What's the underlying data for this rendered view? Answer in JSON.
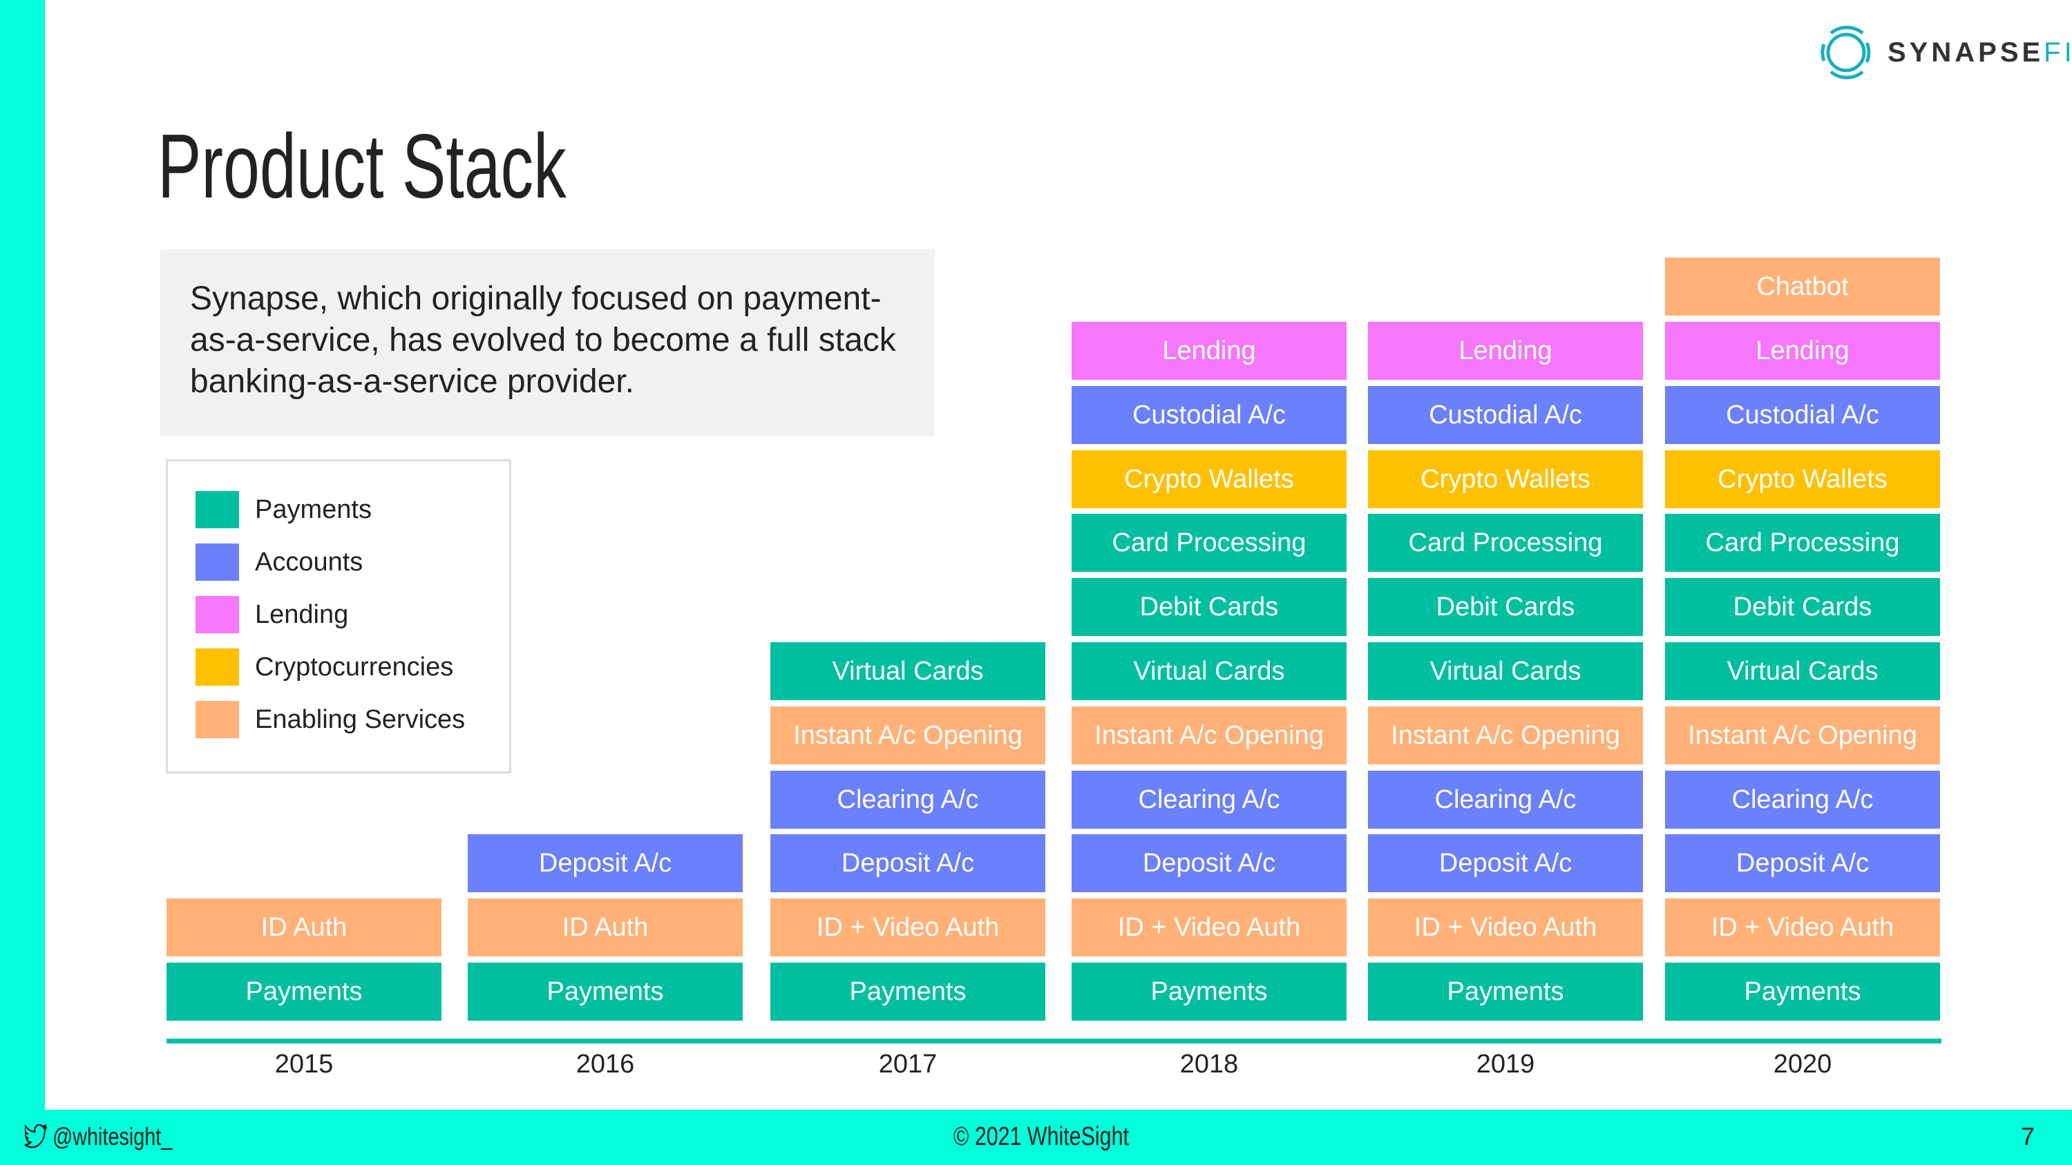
{
  "header": {
    "logo_text": "SYNAPSE",
    "logo_text_suffix": "FI",
    "title": "Product Stack"
  },
  "intro": {
    "text": "Synapse, which originally focused on payment-as-a-service, has evolved to become a full stack banking-as-a-service provider."
  },
  "colors": {
    "Payments": "#00BFA0",
    "Accounts": "#6B80FB",
    "Lending": "#F577FA",
    "Cryptocurrencies": "#FFC000",
    "Enabling Services": "#FFB177",
    "brand_teal": "#00FFDA",
    "axis": "#00BFA5"
  },
  "legend": [
    {
      "label": "Payments",
      "category": "Payments"
    },
    {
      "label": "Accounts",
      "category": "Accounts"
    },
    {
      "label": "Lending",
      "category": "Lending"
    },
    {
      "label": "Cryptocurrencies",
      "category": "Cryptocurrencies"
    },
    {
      "label": "Enabling Services",
      "category": "Enabling Services"
    }
  ],
  "chart_data": {
    "type": "table",
    "title": "Product Stack",
    "categories": [
      "2015",
      "2016",
      "2017",
      "2018",
      "2019",
      "2020"
    ],
    "stacks": [
      {
        "year": "2015",
        "items": [
          {
            "label": "Payments",
            "category": "Payments"
          },
          {
            "label": "ID Auth",
            "category": "Enabling Services"
          }
        ]
      },
      {
        "year": "2016",
        "items": [
          {
            "label": "Payments",
            "category": "Payments"
          },
          {
            "label": "ID Auth",
            "category": "Enabling Services"
          },
          {
            "label": "Deposit A/c",
            "category": "Accounts"
          }
        ]
      },
      {
        "year": "2017",
        "items": [
          {
            "label": "Payments",
            "category": "Payments"
          },
          {
            "label": "ID + Video Auth",
            "category": "Enabling Services"
          },
          {
            "label": "Deposit A/c",
            "category": "Accounts"
          },
          {
            "label": "Clearing A/c",
            "category": "Accounts"
          },
          {
            "label": "Instant A/c Opening",
            "category": "Enabling Services"
          },
          {
            "label": "Virtual Cards",
            "category": "Payments"
          }
        ]
      },
      {
        "year": "2018",
        "items": [
          {
            "label": "Payments",
            "category": "Payments"
          },
          {
            "label": "ID + Video Auth",
            "category": "Enabling Services"
          },
          {
            "label": "Deposit A/c",
            "category": "Accounts"
          },
          {
            "label": "Clearing A/c",
            "category": "Accounts"
          },
          {
            "label": "Instant A/c Opening",
            "category": "Enabling Services"
          },
          {
            "label": "Virtual Cards",
            "category": "Payments"
          },
          {
            "label": "Debit Cards",
            "category": "Payments"
          },
          {
            "label": "Card Processing",
            "category": "Payments"
          },
          {
            "label": "Crypto Wallets",
            "category": "Cryptocurrencies"
          },
          {
            "label": "Custodial A/c",
            "category": "Accounts"
          },
          {
            "label": "Lending",
            "category": "Lending"
          }
        ]
      },
      {
        "year": "2019",
        "items": [
          {
            "label": "Payments",
            "category": "Payments"
          },
          {
            "label": "ID + Video Auth",
            "category": "Enabling Services"
          },
          {
            "label": "Deposit A/c",
            "category": "Accounts"
          },
          {
            "label": "Clearing A/c",
            "category": "Accounts"
          },
          {
            "label": "Instant A/c Opening",
            "category": "Enabling Services"
          },
          {
            "label": "Virtual Cards",
            "category": "Payments"
          },
          {
            "label": "Debit Cards",
            "category": "Payments"
          },
          {
            "label": "Card Processing",
            "category": "Payments"
          },
          {
            "label": "Crypto Wallets",
            "category": "Cryptocurrencies"
          },
          {
            "label": "Custodial A/c",
            "category": "Accounts"
          },
          {
            "label": "Lending",
            "category": "Lending"
          }
        ]
      },
      {
        "year": "2020",
        "items": [
          {
            "label": "Payments",
            "category": "Payments"
          },
          {
            "label": "ID + Video Auth",
            "category": "Enabling Services"
          },
          {
            "label": "Deposit A/c",
            "category": "Accounts"
          },
          {
            "label": "Clearing A/c",
            "category": "Accounts"
          },
          {
            "label": "Instant A/c Opening",
            "category": "Enabling Services"
          },
          {
            "label": "Virtual Cards",
            "category": "Payments"
          },
          {
            "label": "Debit Cards",
            "category": "Payments"
          },
          {
            "label": "Card Processing",
            "category": "Payments"
          },
          {
            "label": "Crypto Wallets",
            "category": "Cryptocurrencies"
          },
          {
            "label": "Custodial A/c",
            "category": "Accounts"
          },
          {
            "label": "Lending",
            "category": "Lending"
          },
          {
            "label": "Chatbot",
            "category": "Enabling Services"
          }
        ]
      }
    ]
  },
  "footer": {
    "twitter_handle": "@whitesight_",
    "copyright": "© 2021 WhiteSight",
    "page_number": "7"
  }
}
